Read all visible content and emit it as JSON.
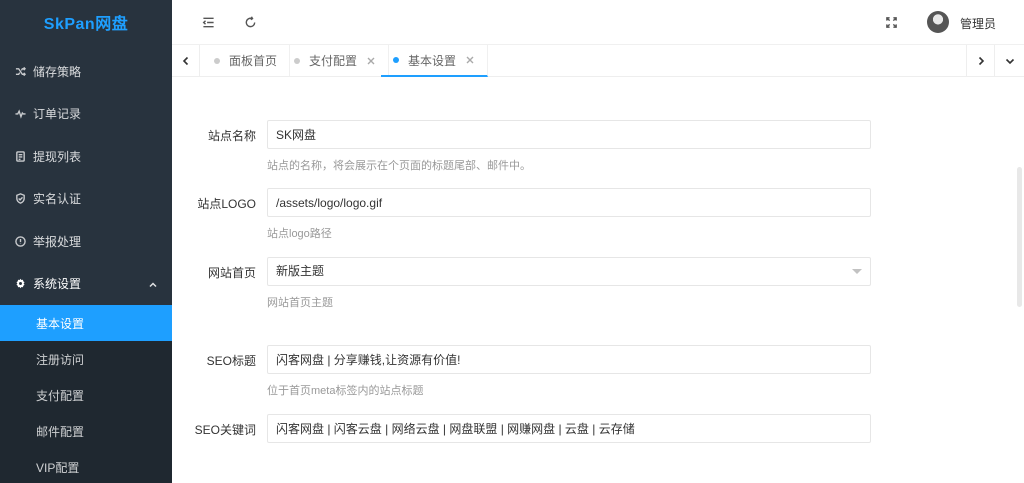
{
  "app": {
    "logo": "SkPan网盘"
  },
  "sidebar": {
    "items": [
      {
        "label": "储存策略",
        "icon": "shuffle-icon"
      },
      {
        "label": "订单记录",
        "icon": "pulse-icon"
      },
      {
        "label": "提现列表",
        "icon": "list-icon"
      },
      {
        "label": "实名认证",
        "icon": "shield-check-icon"
      },
      {
        "label": "举报处理",
        "icon": "alert-circle-icon"
      },
      {
        "label": "系统设置",
        "icon": "gear-icon",
        "expanded": true
      }
    ],
    "submenu": [
      {
        "label": "基本设置",
        "active": true
      },
      {
        "label": "注册访问"
      },
      {
        "label": "支付配置"
      },
      {
        "label": "邮件配置"
      },
      {
        "label": "VIP配置"
      }
    ]
  },
  "header": {
    "username": "管理员"
  },
  "tabs": [
    {
      "label": "面板首页",
      "closable": false,
      "active": false
    },
    {
      "label": "支付配置",
      "closable": true,
      "active": false
    },
    {
      "label": "基本设置",
      "closable": true,
      "active": true
    }
  ],
  "form": {
    "site_name": {
      "label": "站点名称",
      "value": "SK网盘",
      "hint": "站点的名称，将会展示在个页面的标题尾部、邮件中。"
    },
    "site_logo": {
      "label": "站点LOGO",
      "value": "/assets/logo/logo.gif",
      "hint": "站点logo路径"
    },
    "homepage": {
      "label": "网站首页",
      "value": "新版主题",
      "hint": "网站首页主题"
    },
    "seo_title": {
      "label": "SEO标题",
      "value": "闪客网盘 | 分享赚钱,让资源有价值!",
      "hint": "位于首页meta标签内的站点标题"
    },
    "seo_keywords": {
      "label": "SEO关键词",
      "value": "闪客网盘 | 闪客云盘 | 网络云盘 | 网盘联盟 | 网赚网盘 | 云盘 | 云存储"
    }
  },
  "colors": {
    "accent": "#1E9FFF",
    "sidebar_bg": "#28333e",
    "submenu_bg": "#1f2830"
  }
}
